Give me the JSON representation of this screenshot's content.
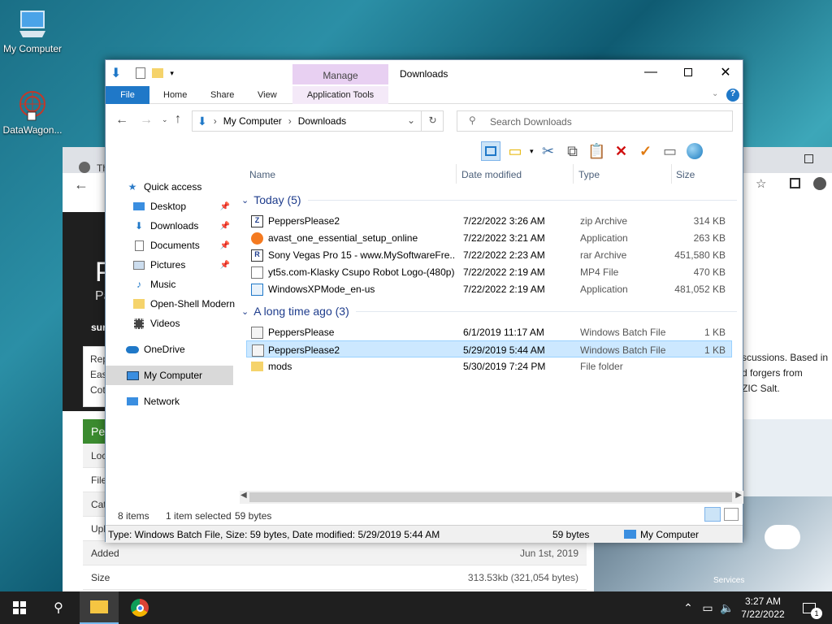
{
  "desktop": {
    "icons": [
      {
        "label": "My Computer"
      },
      {
        "label": "DataWagon..."
      }
    ]
  },
  "browser_bg": {
    "tab_partial": "Th",
    "content_letter_p": "P",
    "content_letters_pa": "Pa",
    "content_sur": "sur",
    "card_lines": [
      "Rep",
      "Eas",
      "Cot"
    ],
    "side_text": [
      "scussions. Based in",
      "d forgers from",
      "ZIC Salt."
    ],
    "green_bar": "Pe",
    "rows": [
      {
        "label": "Loc",
        "value": ""
      },
      {
        "label": "File",
        "value": ""
      },
      {
        "label": "Cat",
        "value": ""
      },
      {
        "label": "Upl",
        "value": ""
      },
      {
        "label": "Added",
        "value": "Jun 1st, 2019"
      },
      {
        "label": "Size",
        "value": "313.53kb (321,054 bytes)"
      }
    ],
    "ad_label": "Services"
  },
  "explorer": {
    "title": "Downloads",
    "manage_tab": "Manage",
    "tabs": [
      "File",
      "Home",
      "Share",
      "View",
      "Application Tools"
    ],
    "breadcrumb": [
      "My Computer",
      "Downloads"
    ],
    "search_placeholder": "Search Downloads",
    "nav": [
      {
        "label": "Quick access",
        "icon": "star-icon"
      },
      {
        "label": "Desktop",
        "icon": "desktop-icon",
        "pinned": true
      },
      {
        "label": "Downloads",
        "icon": "download-arrow-icon",
        "pinned": true
      },
      {
        "label": "Documents",
        "icon": "documents-icon",
        "pinned": true
      },
      {
        "label": "Pictures",
        "icon": "pictures-icon",
        "pinned": true
      },
      {
        "label": "Music",
        "icon": "music-icon"
      },
      {
        "label": "Open-Shell Modern",
        "icon": "folder-icon"
      },
      {
        "label": "Videos",
        "icon": "videos-icon"
      },
      {
        "label": "OneDrive",
        "icon": "cloud-icon"
      },
      {
        "label": "My Computer",
        "icon": "computer-icon"
      },
      {
        "label": "Network",
        "icon": "network-icon"
      }
    ],
    "columns": [
      "Name",
      "Date modified",
      "Type",
      "Size"
    ],
    "groups": [
      {
        "label": "Today (5)",
        "files": [
          {
            "name": "PeppersPlease2",
            "date": "7/22/2022 3:26 AM",
            "type": "zip Archive",
            "size": "314 KB",
            "icon": "zip-icon"
          },
          {
            "name": "avast_one_essential_setup_online",
            "date": "7/22/2022 3:21 AM",
            "type": "Application",
            "size": "263 KB",
            "icon": "avast-icon"
          },
          {
            "name": "Sony Vegas Pro 15 - www.MySoftwareFre...",
            "date": "7/22/2022 2:23 AM",
            "type": "rar Archive",
            "size": "451,580 KB",
            "icon": "rar-icon"
          },
          {
            "name": "yt5s.com-Klasky Csupo Robot Logo-(480p)",
            "date": "7/22/2022 2:19 AM",
            "type": "MP4 File",
            "size": "470 KB",
            "icon": "video-file-icon"
          },
          {
            "name": "WindowsXPMode_en-us",
            "date": "7/22/2022 2:19 AM",
            "type": "Application",
            "size": "481,052 KB",
            "icon": "app-icon"
          }
        ]
      },
      {
        "label": "A long time ago (3)",
        "files": [
          {
            "name": "PeppersPlease",
            "date": "6/1/2019 11:17 AM",
            "type": "Windows Batch File",
            "size": "1 KB",
            "icon": "batch-icon"
          },
          {
            "name": "PeppersPlease2",
            "date": "5/29/2019 5:44 AM",
            "type": "Windows Batch File",
            "size": "1 KB",
            "icon": "batch-icon",
            "selected": true
          },
          {
            "name": "mods",
            "date": "5/30/2019 7:24 PM",
            "type": "File folder",
            "size": "",
            "icon": "folder-icon"
          }
        ]
      }
    ],
    "status": {
      "count": "8 items",
      "selected": "1 item selected",
      "bytes": "59 bytes"
    },
    "details": {
      "text": "Type: Windows Batch File, Size: 59 bytes, Date modified: 5/29/2019 5:44 AM",
      "size": "59 bytes",
      "location": "My Computer"
    }
  },
  "taskbar": {
    "time": "3:27 AM",
    "date": "7/22/2022",
    "notifications": "1"
  }
}
